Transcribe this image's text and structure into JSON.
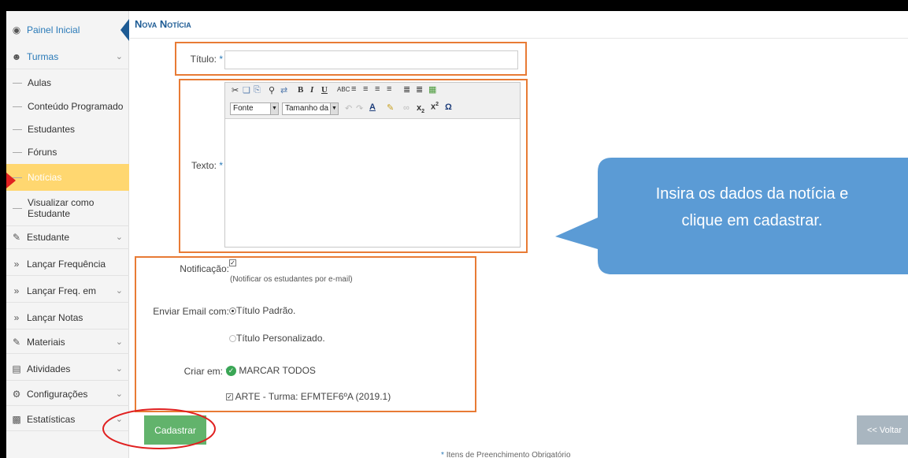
{
  "sidebar": {
    "items": [
      {
        "label": "Painel Inicial"
      },
      {
        "label": "Turmas"
      },
      {
        "label": "Estudante"
      },
      {
        "label": "Lançar Frequência"
      },
      {
        "label": "Lançar Freq. em"
      },
      {
        "label": "Lançar Notas"
      },
      {
        "label": "Materiais"
      },
      {
        "label": "Atividades"
      },
      {
        "label": "Configurações"
      },
      {
        "label": "Estatísticas"
      }
    ],
    "subitems": [
      {
        "label": "Aulas"
      },
      {
        "label": "Conteúdo Programado"
      },
      {
        "label": "Estudantes"
      },
      {
        "label": "Fóruns"
      },
      {
        "label": "Notícias"
      },
      {
        "label": "Visualizar como Estudante"
      }
    ]
  },
  "page": {
    "title": "Nova Notícia"
  },
  "form": {
    "titulo_label": "Título:",
    "titulo_value": "",
    "texto_label": "Texto:",
    "editor": {
      "font_select": "Fonte",
      "size_select": "Tamanho da"
    },
    "notificacao_label": "Notificação:",
    "notificacao_hint": "(Notificar os estudantes por e-mail)",
    "enviar_label": "Enviar Email com:",
    "radio_padrao": "Título Padrão.",
    "radio_personalizado": "Título Personalizado.",
    "criar_label": "Criar em:",
    "marcar_todos": "MARCAR TODOS",
    "turma_option": "ARTE - Turma: EFMTEF6ºA (2019.1)",
    "required_mark": "*"
  },
  "buttons": {
    "cadastrar": "Cadastrar",
    "voltar": "<< Voltar"
  },
  "footer": {
    "note": "Itens de Preenchimento Obrigatório"
  },
  "callout": {
    "line1": "Insira os dados da notícia e",
    "line2": "clique em cadastrar."
  },
  "colors": {
    "annotation_orange": "#e87b35",
    "callout_blue": "#5b9bd5",
    "highlight_red": "#e02020",
    "active_yellow": "#ffd770"
  }
}
